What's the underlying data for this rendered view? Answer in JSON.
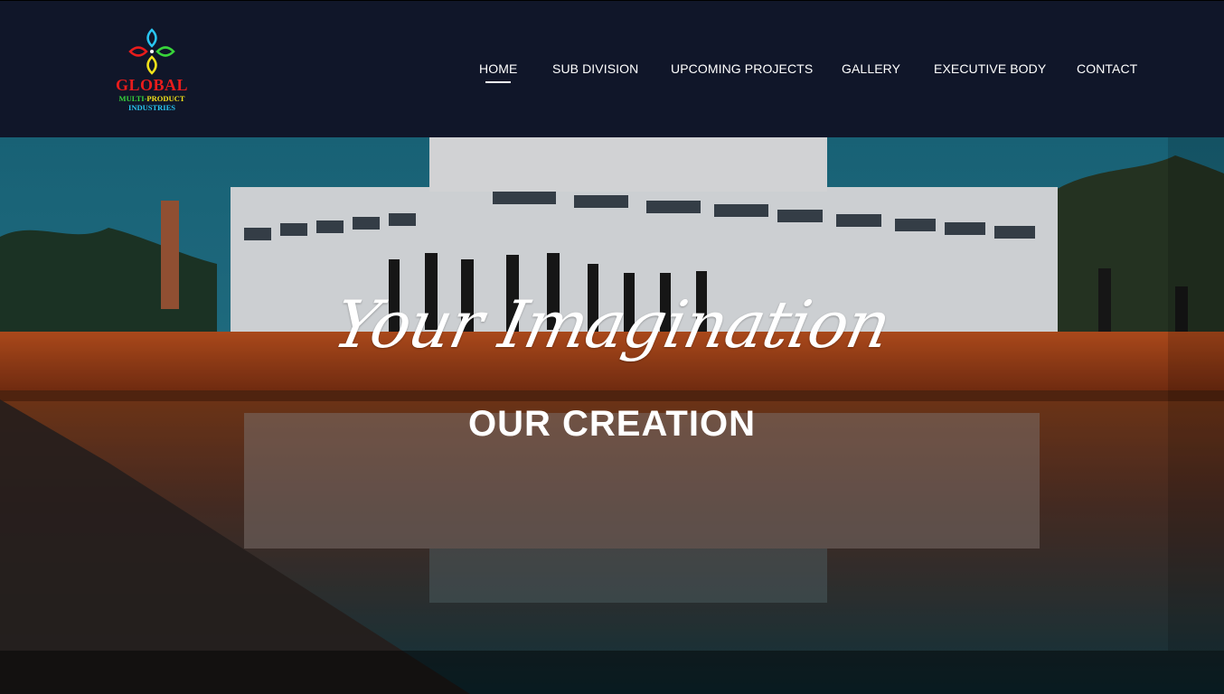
{
  "logo": {
    "title": "GLOBAL",
    "subtitle_part1": "MULTI-",
    "subtitle_part2": "PRODUCT",
    "subtitle_line2": "INDUSTRIES",
    "colors": {
      "red": "#e81c1c",
      "green": "#38d43a",
      "blue": "#29c6f2",
      "yellow": "#f2e21a"
    }
  },
  "nav": {
    "items": [
      {
        "label": "HOME",
        "active": true
      },
      {
        "label": "SUB DIVISION",
        "active": false
      },
      {
        "label": "UPCOMING PROJECTS",
        "active": false
      },
      {
        "label": "GALLERY",
        "active": false
      },
      {
        "label": "EXECUTIVE BODY",
        "active": false
      },
      {
        "label": "CONTACT",
        "active": false
      }
    ]
  },
  "hero": {
    "script_text": "Your Imagination",
    "title": "OUR CREATION",
    "image": "temple-with-reflecting-pool"
  },
  "colors": {
    "header_bg": "#101629",
    "text": "#ffffff"
  }
}
